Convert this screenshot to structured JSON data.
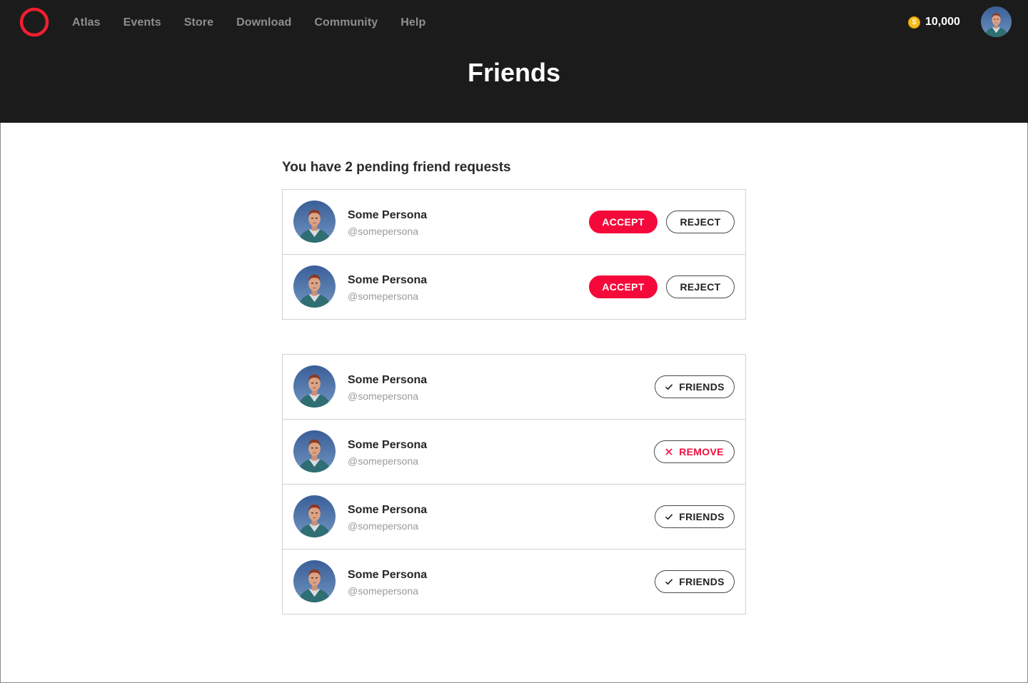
{
  "nav": {
    "items": [
      "Atlas",
      "Events",
      "Store",
      "Download",
      "Community",
      "Help"
    ]
  },
  "account": {
    "currency_symbol": "$",
    "balance": "10,000"
  },
  "page": {
    "title": "Friends"
  },
  "pending": {
    "heading": "You have 2 pending friend requests",
    "accept_label": "ACCEPT",
    "reject_label": "REJECT",
    "requests": [
      {
        "name": "Some Persona",
        "handle": "@somepersona"
      },
      {
        "name": "Some Persona",
        "handle": "@somepersona"
      }
    ]
  },
  "friends": {
    "friends_label": "FRIENDS",
    "remove_label": "REMOVE",
    "list": [
      {
        "name": "Some Persona",
        "handle": "@somepersona",
        "state": "friends"
      },
      {
        "name": "Some Persona",
        "handle": "@somepersona",
        "state": "remove"
      },
      {
        "name": "Some Persona",
        "handle": "@somepersona",
        "state": "friends"
      },
      {
        "name": "Some Persona",
        "handle": "@somepersona",
        "state": "friends"
      }
    ]
  },
  "colors": {
    "brand_red": "#f5093a",
    "header_bg": "#1b1b1b",
    "coin": "#f6b91a"
  }
}
